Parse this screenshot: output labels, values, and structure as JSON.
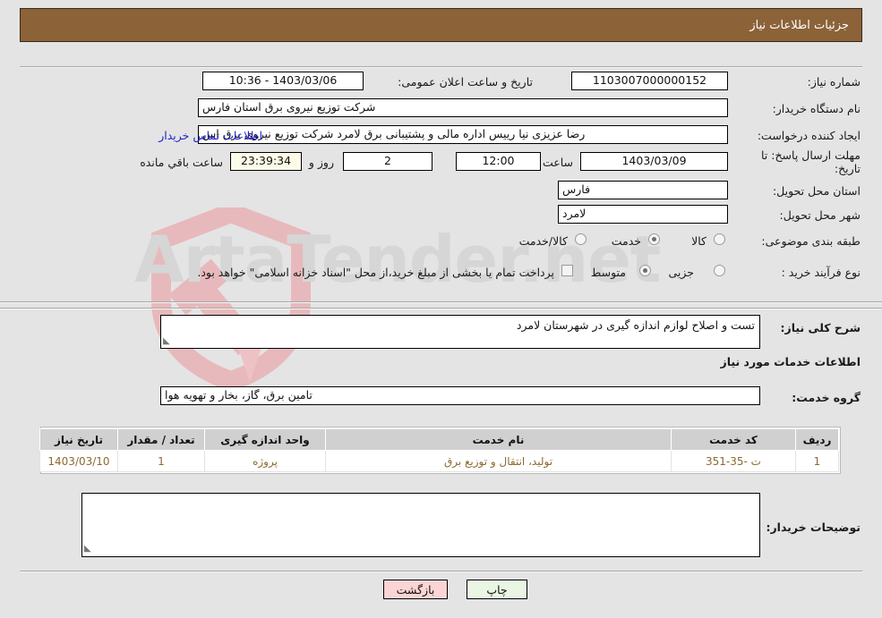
{
  "window": {
    "title": "جزئیات اطلاعات نیاز"
  },
  "watermark": {
    "text": "ArtaTender.net",
    "logo_icon": "shield-gavel-icon"
  },
  "form": {
    "need_number": {
      "label": "شماره نیاز:",
      "value": "1103007000000152"
    },
    "announce_datetime": {
      "label": "تاریخ و ساعت اعلان عمومی:",
      "value": "1403/03/06 - 10:36"
    },
    "buyer_org": {
      "label": "نام دستگاه خریدار:",
      "value": "شرکت توزیع نیروی برق استان فارس"
    },
    "request_creator": {
      "label": "ایجاد کننده درخواست:",
      "value": "رضا عزیزی نیا رییس اداره مالی و پشتیبانی برق لامرد شرکت توزیع نیروی برق اس",
      "contact_link": "اطلاعات تماس خریدار"
    },
    "response_deadline": {
      "label": "مهلت ارسال پاسخ: تا تاریخ:",
      "date": "1403/03/09",
      "time_label": "ساعت",
      "time": "12:00",
      "days": "2",
      "days_label": "روز و",
      "countdown": "23:39:34",
      "remaining_label": "ساعت باقي مانده"
    },
    "delivery_province": {
      "label": "استان محل تحویل:",
      "value": "فارس"
    },
    "delivery_city": {
      "label": "شهر محل تحویل:",
      "value": "لامرد"
    },
    "subject_category": {
      "label": "طبقه بندی موضوعی:",
      "options": [
        {
          "label": "کالا",
          "selected": false
        },
        {
          "label": "خدمت",
          "selected": true
        },
        {
          "label": "کالا/خدمت",
          "selected": false
        }
      ]
    },
    "purchase_process": {
      "label": "نوع فرآیند خرید :",
      "options": [
        {
          "label": "جزیی",
          "selected": false
        },
        {
          "label": "متوسط",
          "selected": true
        }
      ],
      "treasury_checkbox": {
        "checked": false,
        "text": "پرداخت تمام یا بخشی از مبلغ خرید،از محل \"اسناد خزانه اسلامی\" خواهد بود."
      }
    },
    "general_description": {
      "label": "شرح کلی نیاز:",
      "value": "تست و اصلاح لوازم اندازه گیری در شهرستان لامرد"
    },
    "services_section_title": "اطلاعات خدمات مورد نیاز",
    "service_group": {
      "label": "گروه خدمت:",
      "value": "تامین برق، گاز، بخار و تهویه هوا"
    },
    "buyer_notes": {
      "label": "توضیحات خریدار:",
      "value": ""
    }
  },
  "table": {
    "columns": [
      "ردیف",
      "کد خدمت",
      "نام خدمت",
      "واحد اندازه گیری",
      "تعداد / مقدار",
      "تاریخ نیاز"
    ],
    "rows": [
      {
        "row_no": "1",
        "service_code": "ت -35-351",
        "service_name": "تولید، انتقال و توزیع برق",
        "unit": "پروژه",
        "quantity": "1",
        "need_date": "1403/03/10"
      }
    ]
  },
  "footer": {
    "print_button": "چاپ",
    "back_button": "بازگشت"
  },
  "colors": {
    "titlebar_bg": "#8c6239",
    "page_bg": "#e4e4e4",
    "link": "#2222cc",
    "print_btn": "#e9f6e4",
    "back_btn": "#fbd5d5",
    "table_header": "#d0d0d0",
    "table_text": "#8a6a2f"
  }
}
